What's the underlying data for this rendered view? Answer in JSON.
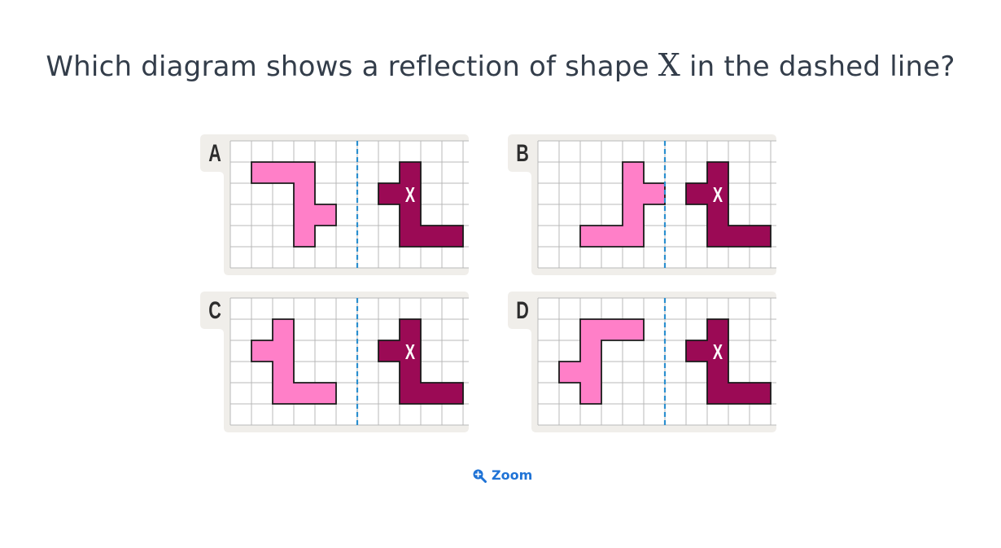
{
  "question": {
    "prefix": "Which diagram shows a reflection of shape ",
    "variable": "X",
    "suffix": " in the dashed line?"
  },
  "colors": {
    "panel_bg": "#f0eeea",
    "grid_line": "#b9b9b9",
    "grid_bg": "#ffffff",
    "dashed_line": "#2b8fcf",
    "shape_x_fill": "#9b0a55",
    "reflection_fill": "#ff7fc8",
    "outline": "#1a1a1a",
    "label_text": "#2d2d2d",
    "zoom_text": "#1f73d6"
  },
  "grid": {
    "cols": 12,
    "rows": 6,
    "mirror_after_col": 6
  },
  "shape_x": {
    "label": "X",
    "cells": [
      [
        8,
        1
      ],
      [
        7,
        2
      ],
      [
        8,
        2
      ],
      [
        8,
        3
      ],
      [
        8,
        4
      ],
      [
        9,
        4
      ],
      [
        10,
        4
      ]
    ]
  },
  "options": [
    {
      "label": "A",
      "cells": [
        [
          1,
          1
        ],
        [
          2,
          1
        ],
        [
          3,
          1
        ],
        [
          3,
          2
        ],
        [
          3,
          3
        ],
        [
          4,
          3
        ],
        [
          3,
          4
        ]
      ]
    },
    {
      "label": "B",
      "cells": [
        [
          4,
          1
        ],
        [
          4,
          2
        ],
        [
          5,
          2
        ],
        [
          4,
          3
        ],
        [
          2,
          4
        ],
        [
          3,
          4
        ],
        [
          4,
          4
        ]
      ]
    },
    {
      "label": "C",
      "cells": [
        [
          2,
          1
        ],
        [
          1,
          2
        ],
        [
          2,
          2
        ],
        [
          2,
          3
        ],
        [
          2,
          4
        ],
        [
          3,
          4
        ],
        [
          4,
          4
        ]
      ]
    },
    {
      "label": "D",
      "cells": [
        [
          2,
          1
        ],
        [
          3,
          1
        ],
        [
          4,
          1
        ],
        [
          2,
          2
        ],
        [
          1,
          3
        ],
        [
          2,
          3
        ],
        [
          2,
          4
        ]
      ]
    }
  ],
  "zoom": {
    "label": "Zoom",
    "icon": "zoom-in-icon"
  }
}
